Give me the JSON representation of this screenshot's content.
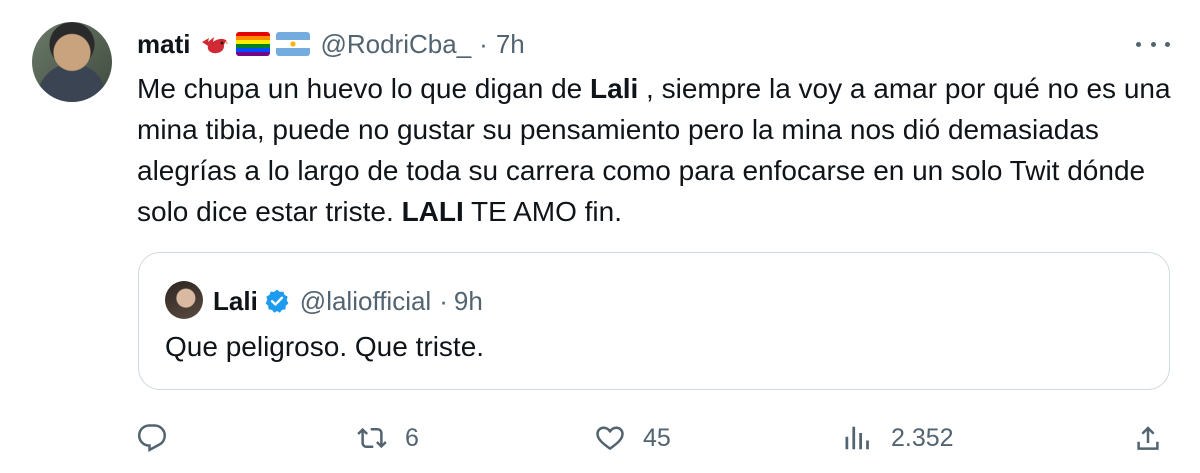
{
  "author": {
    "name": "mati",
    "handle": "@RodriCba_",
    "separator": "·",
    "time": "7h"
  },
  "tweet": {
    "segments": [
      {
        "text": "Me chupa un huevo lo que digan de ",
        "bold": false
      },
      {
        "text": "Lali",
        "bold": true
      },
      {
        "text": " , siempre la voy a amar por qué no es una mina tibia, puede no gustar su pensamiento pero la mina nos dió demasiadas alegrías a lo largo de toda su carrera como para enfocarse en un solo Twit dónde solo dice estar triste. ",
        "bold": false
      },
      {
        "text": "LALI",
        "bold": true
      },
      {
        "text": " TE AMO fin.",
        "bold": false
      }
    ]
  },
  "quoted": {
    "name": "Lali",
    "handle": "@laliofficial",
    "separator": "·",
    "time": "9h",
    "text": "Que peligroso. Que triste."
  },
  "actions": {
    "reply": {
      "icon": "reply-icon",
      "count": ""
    },
    "retweet": {
      "icon": "retweet-icon",
      "count": "6"
    },
    "like": {
      "icon": "heart-icon",
      "count": "45"
    },
    "views": {
      "icon": "views-icon",
      "count": "2.352"
    },
    "share": {
      "icon": "share-icon",
      "count": ""
    }
  },
  "colors": {
    "text": "#0f1419",
    "secondary": "#536471",
    "border": "#cfd9de",
    "verified": "#1d9bf0"
  }
}
